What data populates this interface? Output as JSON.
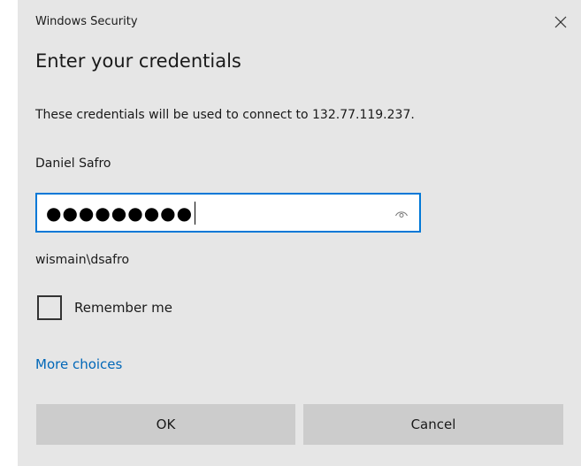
{
  "window": {
    "title": "Windows Security",
    "close_icon": "close-icon"
  },
  "dialog": {
    "heading": "Enter your credentials",
    "description": "These credentials will be used to connect to 132.77.119.237.",
    "user_display_name": "Daniel Safro",
    "password": {
      "masked_value": "●●●●●●●●●",
      "reveal_icon": "eye-icon",
      "focused": true
    },
    "domain_user": "wismain\\dsafro",
    "remember_me": {
      "label": "Remember me",
      "checked": false
    },
    "more_choices_label": "More choices",
    "buttons": {
      "ok_label": "OK",
      "cancel_label": "Cancel"
    }
  },
  "colors": {
    "dialog_bg": "#e6e6e6",
    "accent_blue": "#0078d7",
    "link_blue": "#0067b8",
    "button_bg": "#cccccc"
  }
}
